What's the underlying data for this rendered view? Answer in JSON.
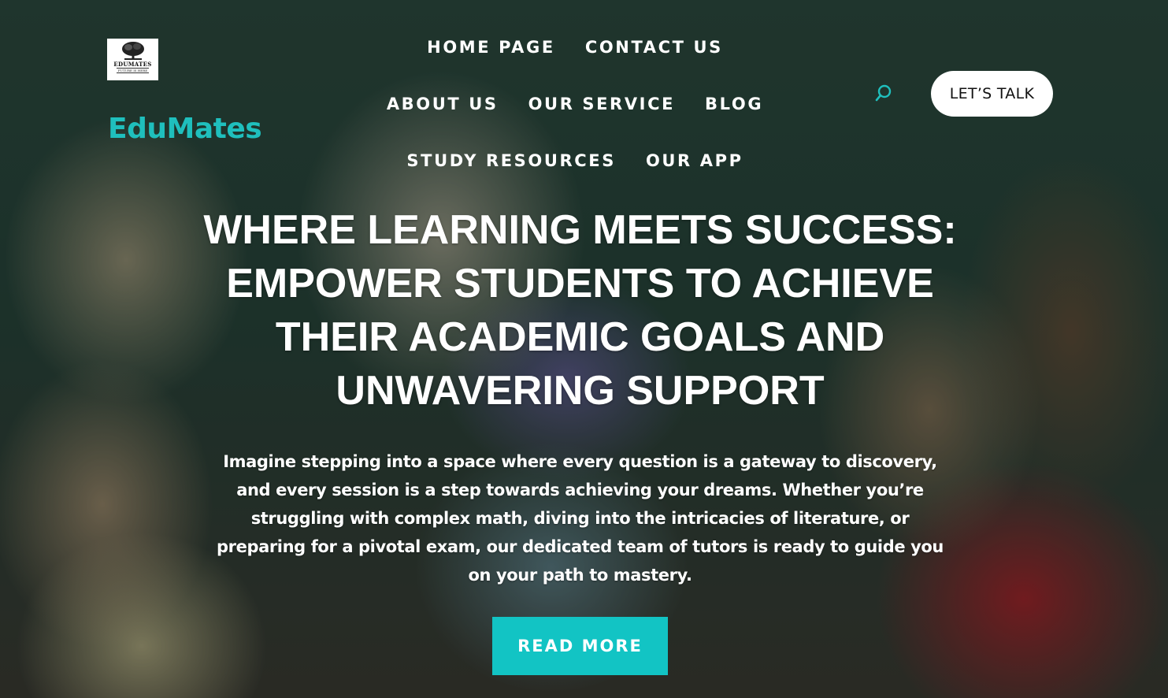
{
  "logo": {
    "icon": "tree-logo-icon",
    "name": "EDUMATES",
    "tagline": "FUTURE IS HERE"
  },
  "brand": {
    "name": "EduMates",
    "color": "#1fbfbd"
  },
  "nav": {
    "rows": [
      [
        "HOME PAGE",
        "CONTACT US"
      ],
      [
        "ABOUT US",
        "OUR SERVICE",
        "BLOG"
      ],
      [
        "STUDY RESOURCES",
        "OUR APP"
      ]
    ]
  },
  "header": {
    "search_icon": "search-icon",
    "cta_label": "LET’S TALK"
  },
  "hero": {
    "headline": "WHERE LEARNING MEETS SUCCESS: EMPOWER STUDENTS TO ACHIEVE THEIR ACADEMIC GOALS AND UNWAVERING SUPPORT",
    "paragraph": "Imagine stepping into a space where every question is a gateway to discovery, and every session is a step towards achieving your dreams. Whether you’re struggling with complex math, diving into the intricacies of literature, or preparing for a pivotal exam, our dedicated team of tutors is ready to guide you on your path to mastery.",
    "button_label": "READ MORE",
    "button_color": "#12c4c4"
  }
}
